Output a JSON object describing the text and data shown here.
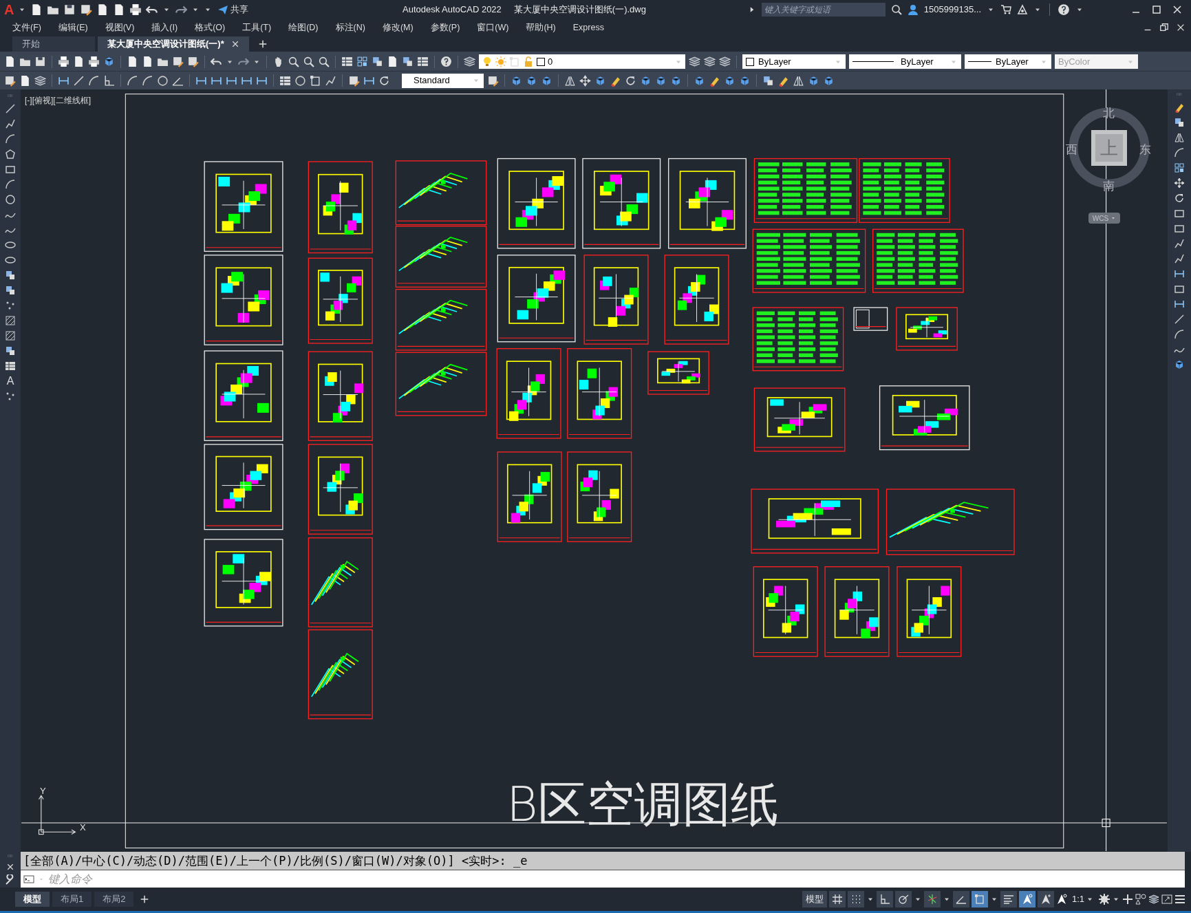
{
  "title_bar": {
    "logo": "A",
    "share": "共享",
    "app_title": "Autodesk AutoCAD 2022",
    "file_title": "某大厦中央空调设计图纸(一).dwg",
    "search": {
      "placeholder": "键入关键字或短语"
    },
    "user": "1505999135..."
  },
  "menu": [
    "文件(F)",
    "编辑(E)",
    "视图(V)",
    "插入(I)",
    "格式(O)",
    "工具(T)",
    "绘图(D)",
    "标注(N)",
    "修改(M)",
    "参数(P)",
    "窗口(W)",
    "帮助(H)",
    "Express"
  ],
  "file_tabs": [
    {
      "label": "开始",
      "selected": false
    },
    {
      "label": "某大厦中央空调设计图纸(一)*",
      "selected": true
    }
  ],
  "properties_toolbar": {
    "layer": "0",
    "color_setting": "ByLayer",
    "linetype": "ByLayer",
    "lineweight": "ByLayer",
    "plot_style": {
      "value": "ByColor",
      "disabled": true
    }
  },
  "styles_toolbar": {
    "text_style": "Standard"
  },
  "draw_toolbar": {
    "text_tool": "A"
  },
  "viewport": {
    "label": "[-][俯视][二维线框]",
    "canvas_title": "B区空调图纸",
    "ucs": {
      "y": "Y",
      "x": "X"
    }
  },
  "viewcube": {
    "north": "北",
    "south": "南",
    "east": "东",
    "west": "西",
    "face": "上",
    "coordinate_system": "WCS"
  },
  "command_line": {
    "history": "[全部(A)/中心(C)/动态(D)/范围(E)/上一个(P)/比例(S)/窗口(W)/对象(O)] <实时>: _e",
    "placeholder": "键入命令"
  },
  "layout_tabs": [
    {
      "label": "模型",
      "selected": true
    },
    {
      "label": "布局1",
      "selected": false
    },
    {
      "label": "布局2",
      "selected": false
    }
  ],
  "status_bar": {
    "space": "模型",
    "annotation_scale": "1:1",
    "toggles": [
      {
        "kind": "grid",
        "on": false
      },
      {
        "kind": "snap",
        "on": false
      },
      {
        "kind": "ortho",
        "on": false
      },
      {
        "kind": "polar",
        "on": false
      },
      {
        "kind": "track",
        "on": false
      },
      {
        "kind": "angle",
        "on": false
      },
      {
        "kind": "osnap",
        "on": true
      },
      {
        "kind": "lineweight",
        "on": false
      },
      {
        "kind": "annotation",
        "on": true
      },
      {
        "kind": "autoscale",
        "on": false
      }
    ]
  }
}
